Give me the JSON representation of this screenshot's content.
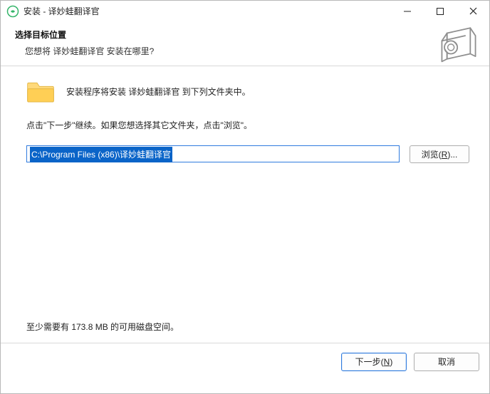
{
  "title": "安装 - 译妙蛙翻译官",
  "header": {
    "heading": "选择目标位置",
    "subheading": "您想将 译妙蛙翻译官 安装在哪里?"
  },
  "body": {
    "intro": "安装程序将安装 译妙蛙翻译官 到下列文件夹中。",
    "hint": "点击\"下一步\"继续。如果您想选择其它文件夹，点击\"浏览\"。",
    "install_path": "C:\\Program Files (x86)\\译妙蛙翻译官",
    "browse_label_prefix": "浏览(",
    "browse_hotkey": "R",
    "browse_label_suffix": ")...",
    "disk_space": "至少需要有 173.8 MB 的可用磁盘空间。"
  },
  "footer": {
    "next_prefix": "下一步(",
    "next_hotkey": "N",
    "next_suffix": ")",
    "cancel": "取消"
  }
}
